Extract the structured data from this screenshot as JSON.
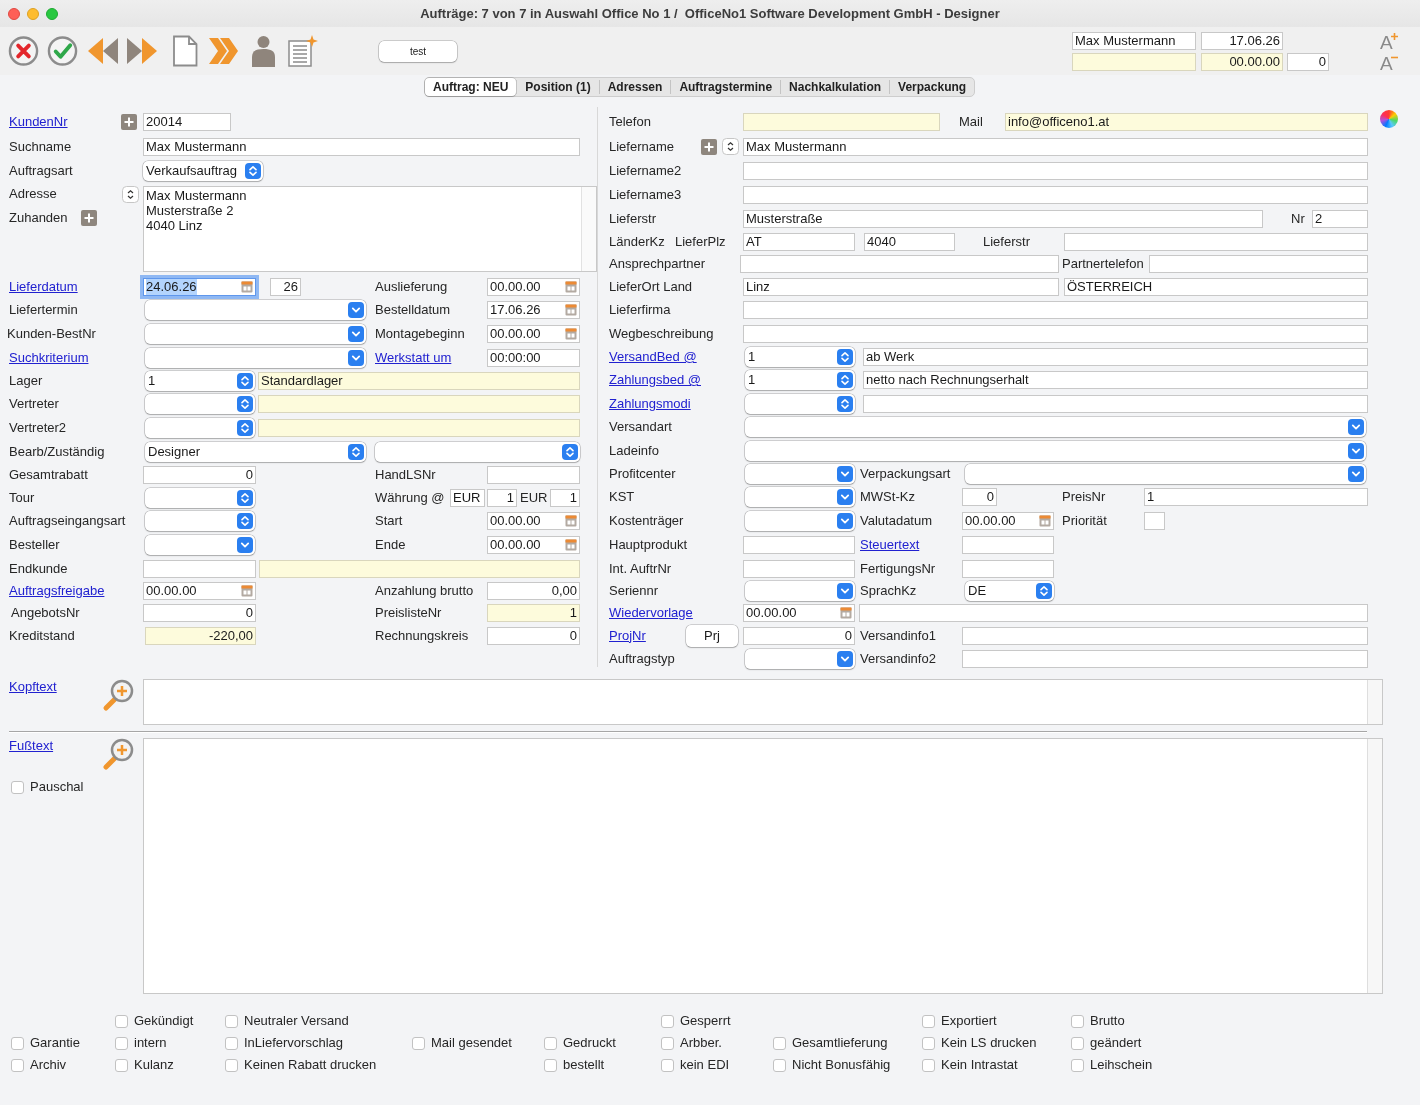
{
  "window": {
    "title": "Aufträge: 7 von 7 in Auswahl Office No 1 /  OfficeNo1 Software Development GmbH - Designer"
  },
  "toolbar": {
    "button": "test",
    "fields": [
      {
        "kind": "field",
        "value": "Max Mustermann"
      },
      {
        "kind": "field",
        "value": "17.06.26"
      },
      {
        "kind": "note"
      },
      {
        "kind": "note",
        "value": "00.00.00"
      },
      {
        "kind": "field",
        "value": "0"
      }
    ],
    "font_buttons": [
      "A",
      "A"
    ]
  },
  "tabs": [
    {
      "label": "Auftrag: NEU",
      "selected": true
    },
    {
      "label": "Position (1)",
      "selected": false
    },
    {
      "label": "Adressen",
      "selected": false
    },
    {
      "label": "Auftragstermine",
      "selected": false
    },
    {
      "label": "Nachkalkulation",
      "selected": false
    },
    {
      "label": "Verpackung",
      "selected": false
    }
  ],
  "left": [
    [
      {
        "kind": "link",
        "text": "KundenNr"
      },
      {
        "kind": "add"
      },
      {
        "kind": "field",
        "value": "20014"
      }
    ],
    [
      {
        "kind": "label",
        "text": "Suchname"
      },
      {
        "kind": "field",
        "value": "Max Mustermann"
      }
    ],
    [
      {
        "kind": "label",
        "text": "Auftragsart"
      },
      {
        "kind": "popup",
        "value": "Verkaufsauftrag"
      }
    ],
    [
      {
        "kind": "label",
        "text": "Adresse"
      },
      {
        "kind": "spin"
      },
      {
        "kind": "label",
        "text": "Zuhanden"
      },
      {
        "kind": "add"
      },
      {
        "kind": "area",
        "lines": [
          "Max Mustermann",
          "Musterstraße 2",
          "4040 Linz"
        ]
      }
    ],
    [
      {
        "kind": "link",
        "text": "Lieferdatum"
      },
      {
        "kind": "date",
        "value": "24.06.26",
        "focused": true
      },
      {
        "kind": "field",
        "value": "26"
      },
      {
        "kind": "label",
        "text": "Auslieferung"
      },
      {
        "kind": "date",
        "value": "00.00.00",
        "focused": false
      }
    ],
    [
      {
        "kind": "label",
        "text": "Liefertermin"
      },
      {
        "kind": "combo"
      },
      {
        "kind": "label",
        "text": "Bestelldatum"
      },
      {
        "kind": "date",
        "value": "17.06.26",
        "focused": false
      }
    ],
    [
      {
        "kind": "label",
        "text": "Kunden-BestNr"
      },
      {
        "kind": "combo"
      },
      {
        "kind": "label",
        "text": "Montagebeginn"
      },
      {
        "kind": "date",
        "value": "00.00.00",
        "focused": false
      }
    ],
    [
      {
        "kind": "link",
        "text": "Suchkriterium"
      },
      {
        "kind": "combo"
      },
      {
        "kind": "link",
        "text": "Werkstatt um"
      },
      {
        "kind": "field",
        "value": "00:00:00"
      }
    ],
    [
      {
        "kind": "label",
        "text": "Lager"
      },
      {
        "kind": "popup",
        "value": "1"
      },
      {
        "kind": "note",
        "value": "Standardlager"
      }
    ],
    [
      {
        "kind": "label",
        "text": "Vertreter"
      },
      {
        "kind": "popup"
      },
      {
        "kind": "note"
      }
    ],
    [
      {
        "kind": "label",
        "text": "Vertreter2"
      },
      {
        "kind": "popup"
      },
      {
        "kind": "note"
      }
    ],
    [
      {
        "kind": "label",
        "text": "Bearb/Zuständig"
      },
      {
        "kind": "popup",
        "value": "Designer"
      },
      {
        "kind": "popup"
      }
    ],
    [
      {
        "kind": "label",
        "text": "Gesamtrabatt"
      },
      {
        "kind": "field",
        "value": "0"
      },
      {
        "kind": "label",
        "text": "HandLSNr"
      },
      {
        "kind": "field"
      }
    ],
    [
      {
        "kind": "label",
        "text": "Tour"
      },
      {
        "kind": "popup"
      },
      {
        "kind": "label",
        "text": "Währung @"
      },
      {
        "kind": "field",
        "value": "EUR"
      },
      {
        "kind": "field",
        "value": "1"
      },
      {
        "kind": "label",
        "text": "EUR"
      },
      {
        "kind": "field",
        "value": "1"
      }
    ],
    [
      {
        "kind": "label",
        "text": "Auftragseingangsart"
      },
      {
        "kind": "popup"
      },
      {
        "kind": "label",
        "text": "Start"
      },
      {
        "kind": "date",
        "value": "00.00.00",
        "focused": false
      }
    ],
    [
      {
        "kind": "label",
        "text": "Besteller"
      },
      {
        "kind": "combo"
      },
      {
        "kind": "label",
        "text": "Ende"
      },
      {
        "kind": "date",
        "value": "00.00.00",
        "focused": false
      }
    ],
    [
      {
        "kind": "label",
        "text": "Endkunde"
      },
      {
        "kind": "field"
      },
      {
        "kind": "note"
      }
    ],
    [
      {
        "kind": "link",
        "text": "Auftragsfreigabe"
      },
      {
        "kind": "date",
        "value": "00.00.00",
        "focused": false
      },
      {
        "kind": "label",
        "text": "Anzahlung brutto"
      },
      {
        "kind": "field",
        "value": "0,00"
      }
    ],
    [
      {
        "kind": "label",
        "text": "AngebotsNr"
      },
      {
        "kind": "field",
        "value": "0"
      },
      {
        "kind": "label",
        "text": "PreislisteNr"
      },
      {
        "kind": "note",
        "value": "1"
      }
    ],
    [
      {
        "kind": "label",
        "text": "Kreditstand"
      },
      {
        "kind": "note",
        "value": "-220,00"
      },
      {
        "kind": "label",
        "text": "Rechnungskreis"
      },
      {
        "kind": "field",
        "value": "0"
      }
    ]
  ],
  "right": [
    [
      {
        "kind": "label",
        "text": "Telefon"
      },
      {
        "kind": "note"
      },
      {
        "kind": "label",
        "text": "Mail"
      },
      {
        "kind": "note",
        "value": "info@officeno1.at"
      }
    ],
    [
      {
        "kind": "label",
        "text": "Liefername"
      },
      {
        "kind": "add"
      },
      {
        "kind": "spin"
      },
      {
        "kind": "field",
        "value": "Max Mustermann"
      }
    ],
    [
      {
        "kind": "label",
        "text": "Liefername2"
      },
      {
        "kind": "field"
      }
    ],
    [
      {
        "kind": "label",
        "text": "Liefername3"
      },
      {
        "kind": "field"
      }
    ],
    [
      {
        "kind": "label",
        "text": "Lieferstr"
      },
      {
        "kind": "field",
        "value": "Musterstraße"
      },
      {
        "kind": "label",
        "text": "Nr"
      },
      {
        "kind": "field",
        "value": "2"
      }
    ],
    [
      {
        "kind": "label",
        "text": "LänderKz"
      },
      {
        "kind": "label",
        "text": "LieferPlz"
      },
      {
        "kind": "field",
        "value": "AT"
      },
      {
        "kind": "field",
        "value": "4040"
      },
      {
        "kind": "label",
        "text": "Lieferstr"
      },
      {
        "kind": "field"
      }
    ],
    [
      {
        "kind": "label",
        "text": "Ansprechpartner"
      },
      {
        "kind": "field"
      },
      {
        "kind": "label",
        "text": "Partnertelefon"
      },
      {
        "kind": "field"
      }
    ],
    [
      {
        "kind": "label",
        "text": "LieferOrt Land"
      },
      {
        "kind": "field",
        "value": "Linz"
      },
      {
        "kind": "field",
        "value": "ÖSTERREICH"
      }
    ],
    [
      {
        "kind": "label",
        "text": "Lieferfirma"
      },
      {
        "kind": "field"
      }
    ],
    [
      {
        "kind": "label",
        "text": "Wegbeschreibung"
      },
      {
        "kind": "field"
      }
    ],
    [
      {
        "kind": "link",
        "text": "VersandBed @"
      },
      {
        "kind": "popup",
        "value": "1"
      },
      {
        "kind": "field",
        "value": "ab Werk"
      }
    ],
    [
      {
        "kind": "link",
        "text": "Zahlungsbed @"
      },
      {
        "kind": "popup",
        "value": "1"
      },
      {
        "kind": "field",
        "value": "netto nach Rechnungserhalt"
      }
    ],
    [
      {
        "kind": "link",
        "text": "Zahlungsmodi"
      },
      {
        "kind": "popup"
      },
      {
        "kind": "field"
      }
    ],
    [
      {
        "kind": "label",
        "text": "Versandart"
      },
      {
        "kind": "combo"
      }
    ],
    [
      {
        "kind": "label",
        "text": "Ladeinfo"
      },
      {
        "kind": "combo"
      }
    ],
    [
      {
        "kind": "label",
        "text": "Profitcenter"
      },
      {
        "kind": "combo"
      },
      {
        "kind": "label",
        "text": "Verpackungsart"
      },
      {
        "kind": "combo"
      }
    ],
    [
      {
        "kind": "label",
        "text": "KST"
      },
      {
        "kind": "combo"
      },
      {
        "kind": "label",
        "text": "MWSt-Kz"
      },
      {
        "kind": "field",
        "value": "0"
      },
      {
        "kind": "label",
        "text": "PreisNr"
      },
      {
        "kind": "field",
        "value": "1"
      }
    ],
    [
      {
        "kind": "label",
        "text": "Kostenträger"
      },
      {
        "kind": "combo"
      },
      {
        "kind": "label",
        "text": "Valutadatum"
      },
      {
        "kind": "date",
        "value": "00.00.00",
        "focused": false
      },
      {
        "kind": "label",
        "text": "Priorität"
      },
      {
        "kind": "field"
      }
    ],
    [
      {
        "kind": "label",
        "text": "Hauptprodukt"
      },
      {
        "kind": "field"
      },
      {
        "kind": "link",
        "text": "Steuertext"
      },
      {
        "kind": "field"
      }
    ],
    [
      {
        "kind": "label",
        "text": "Int. AuftrNr"
      },
      {
        "kind": "field"
      },
      {
        "kind": "label",
        "text": "FertigungsNr"
      },
      {
        "kind": "field"
      }
    ],
    [
      {
        "kind": "label",
        "text": "Seriennr"
      },
      {
        "kind": "combo"
      },
      {
        "kind": "label",
        "text": "SprachKz"
      },
      {
        "kind": "popup",
        "value": "DE"
      }
    ],
    [
      {
        "kind": "link",
        "text": "Wiedervorlage"
      },
      {
        "kind": "date",
        "value": "00.00.00",
        "focused": false
      },
      {
        "kind": "field"
      }
    ],
    [
      {
        "kind": "link",
        "text": "ProjNr"
      },
      {
        "kind": "button",
        "text": "Prj"
      },
      {
        "kind": "field",
        "value": "0"
      },
      {
        "kind": "label",
        "text": "Versandinfo1"
      },
      {
        "kind": "field"
      }
    ],
    [
      {
        "kind": "label",
        "text": "Auftragstyp"
      },
      {
        "kind": "combo"
      },
      {
        "kind": "label",
        "text": "Versandinfo2"
      },
      {
        "kind": "field"
      }
    ]
  ],
  "text_blocks": [
    {
      "label": "Kopftext"
    },
    {
      "label": "Fußtext"
    }
  ],
  "pauschal": {
    "label": "Pauschal",
    "checked": false
  },
  "flags": [
    [
      {
        "label": "Garantie",
        "checked": false
      },
      {
        "label": "Archiv",
        "checked": false
      }
    ],
    [
      {
        "label": "Gekündigt",
        "checked": false
      },
      {
        "label": "intern",
        "checked": false
      },
      {
        "label": "Kulanz",
        "checked": false
      }
    ],
    [
      {
        "label": "Neutraler Versand",
        "checked": false
      },
      {
        "label": "InLiefervorschlag",
        "checked": false
      },
      {
        "label": "Keinen Rabatt drucken",
        "checked": false
      }
    ],
    [
      {
        "label": "Mail gesendet",
        "checked": false
      }
    ],
    [
      {
        "label": "Gedruckt",
        "checked": false
      },
      {
        "label": "bestellt",
        "checked": false
      }
    ],
    [
      {
        "label": "Gesperrt",
        "checked": false
      },
      {
        "label": "Arbber.",
        "checked": false
      },
      {
        "label": "kein EDI",
        "checked": false
      }
    ],
    [
      {
        "label": "Gesamtlieferung",
        "checked": false
      },
      {
        "label": "Nicht Bonusfähig",
        "checked": false
      }
    ],
    [
      {
        "label": "Exportiert",
        "checked": false
      },
      {
        "label": "Kein LS drucken",
        "checked": false
      },
      {
        "label": "Kein Intrastat",
        "checked": false
      }
    ],
    [
      {
        "label": "Brutto",
        "checked": false
      },
      {
        "label": "geändert",
        "checked": false
      },
      {
        "label": "Leihschein",
        "checked": false
      }
    ]
  ]
}
